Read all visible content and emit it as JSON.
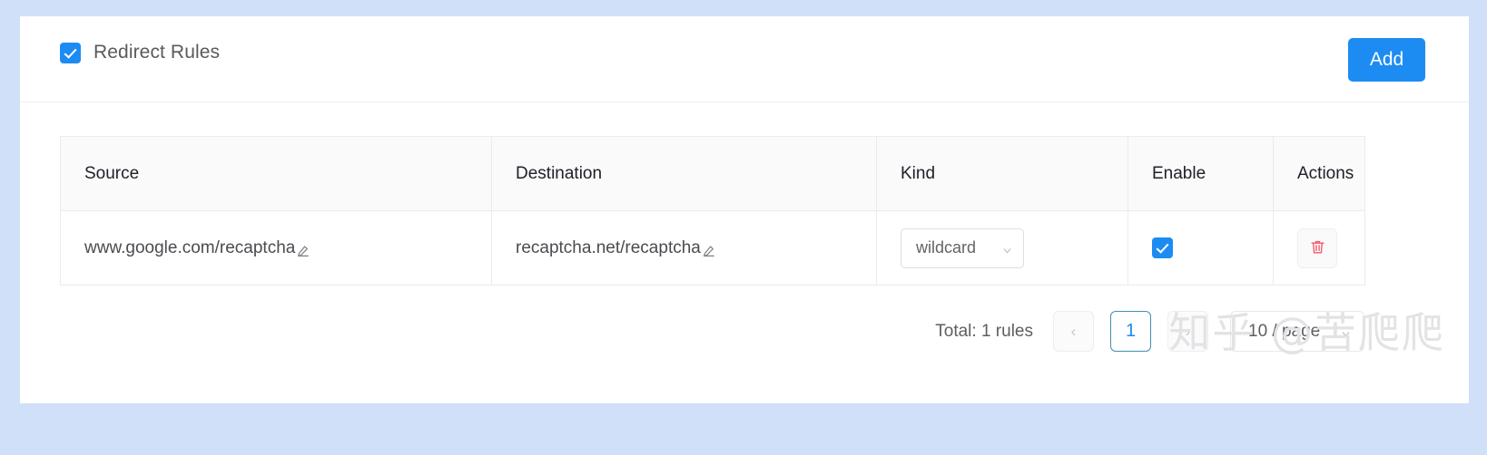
{
  "panel": {
    "title": "Redirect Rules",
    "enabled": true,
    "add_label": "Add",
    "accent_color": "#1c8cf2"
  },
  "table": {
    "columns": [
      "Source",
      "Destination",
      "Kind",
      "Enable",
      "Actions"
    ],
    "rows": [
      {
        "source": "www.google.com/recaptcha",
        "destination": "recaptcha.net/recaptcha",
        "kind": "wildcard",
        "enable": true,
        "edit_icon": "pencil-icon",
        "delete_icon": "trash-icon",
        "delete_color": "#f4576a"
      }
    ]
  },
  "pagination": {
    "total_label": "Total: 1 rules",
    "prev_label": "‹",
    "next_label": "›",
    "pages": [
      "1"
    ],
    "current_page": "1",
    "page_size": "10 / page",
    "current_border_color": "#3f8fae"
  },
  "watermark": {
    "text": "知乎 @苦爬爬"
  }
}
